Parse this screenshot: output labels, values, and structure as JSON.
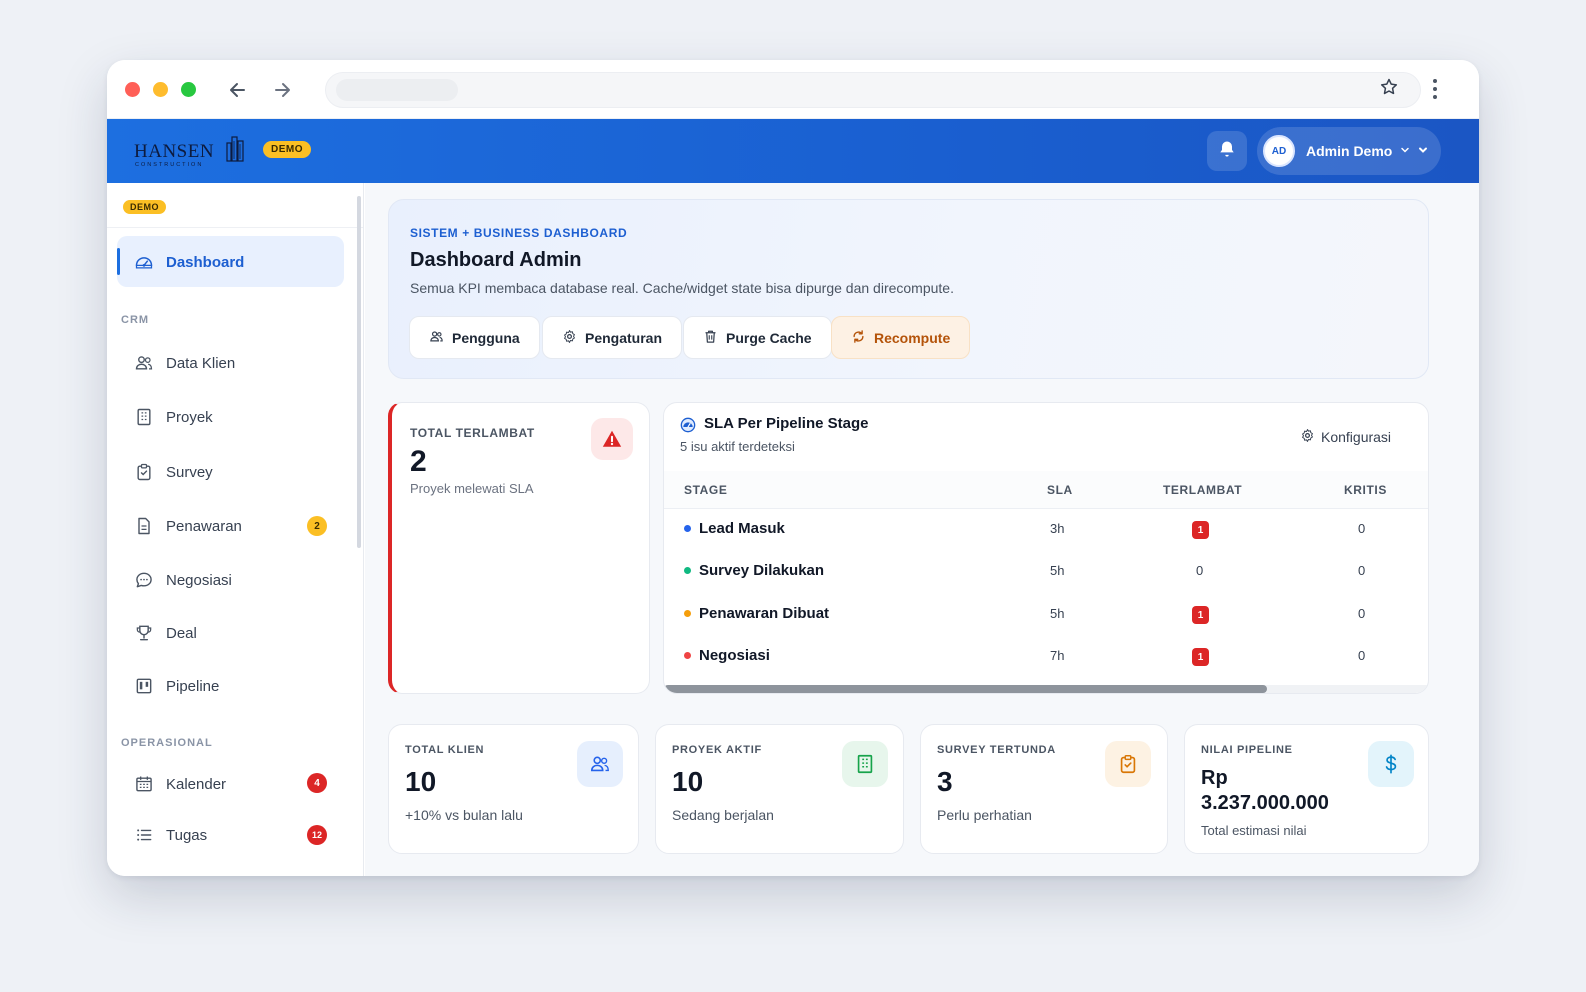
{
  "browser": {
    "icons": [
      "arrow-left-icon",
      "arrow-right-icon",
      "star-icon",
      "kebab-menu-icon"
    ]
  },
  "header": {
    "logo_text": "HANSEN",
    "logo_subtext": "CONSTRUCTION",
    "demo_badge": "DEMO",
    "avatar_initials": "AD",
    "user_name": "Admin Demo",
    "brand_color": "#1d6fe0"
  },
  "sidebar": {
    "demo_badge": "DEMO",
    "active_item": {
      "label": "Dashboard",
      "icon": "gauge-icon"
    },
    "sections": [
      {
        "title": "CRM",
        "items": [
          {
            "label": "Data Klien",
            "icon": "users-icon"
          },
          {
            "label": "Proyek",
            "icon": "building-icon"
          },
          {
            "label": "Survey",
            "icon": "clipboard-check-icon"
          },
          {
            "label": "Penawaran",
            "icon": "document-icon",
            "count": "2"
          },
          {
            "label": "Negosiasi",
            "icon": "chat-bubble-icon"
          },
          {
            "label": "Deal",
            "icon": "trophy-icon"
          },
          {
            "label": "Pipeline",
            "icon": "kanban-icon"
          }
        ]
      },
      {
        "title": "OPERASIONAL",
        "items": [
          {
            "label": "Kalender",
            "icon": "calendar-icon",
            "count": "4"
          },
          {
            "label": "Tugas",
            "icon": "list-icon",
            "count": "12"
          }
        ]
      }
    ]
  },
  "hero": {
    "eyebrow": "SISTEM + BUSINESS DASHBOARD",
    "title": "Dashboard Admin",
    "description": "Semua KPI membaca database real. Cache/widget state bisa dipurge dan direcompute.",
    "buttons": [
      {
        "label": "Pengguna",
        "icon": "users-icon"
      },
      {
        "label": "Pengaturan",
        "icon": "gear-icon"
      },
      {
        "label": "Purge Cache",
        "icon": "trash-icon"
      },
      {
        "label": "Recompute",
        "icon": "refresh-icon"
      }
    ]
  },
  "late_card": {
    "label": "TOTAL TERLAMBAT",
    "value": "2",
    "subtitle": "Proyek melewati SLA",
    "icon": "warning-icon"
  },
  "sla_table": {
    "title": "SLA Per Pipeline Stage",
    "subtitle": "5 isu aktif terdeteksi",
    "config_label": "Konfigurasi",
    "columns": [
      "STAGE",
      "SLA",
      "TERLAMBAT",
      "KRITIS"
    ],
    "rows": [
      {
        "stage": "Lead Masuk",
        "color": "#2563eb",
        "sla": "3h",
        "late": "1",
        "late_badge": true,
        "critical": "0"
      },
      {
        "stage": "Survey Dilakukan",
        "color": "#10b981",
        "sla": "5h",
        "late": "0",
        "late_badge": false,
        "critical": "0"
      },
      {
        "stage": "Penawaran Dibuat",
        "color": "#f59e0b",
        "sla": "5h",
        "late": "1",
        "late_badge": true,
        "critical": "0"
      },
      {
        "stage": "Negosiasi",
        "color": "#ef4444",
        "sla": "7h",
        "late": "1",
        "late_badge": true,
        "critical": "0"
      }
    ]
  },
  "kpis": [
    {
      "label": "TOTAL KLIEN",
      "value": "10",
      "subtitle": "+10% vs bulan lalu",
      "icon": "users-icon",
      "accent": "#2563eb"
    },
    {
      "label": "PROYEK AKTIF",
      "value": "10",
      "subtitle": "Sedang berjalan",
      "icon": "building-icon",
      "accent": "#16a34a"
    },
    {
      "label": "SURVEY TERTUNDA",
      "value": "3",
      "subtitle": "Perlu perhatian",
      "icon": "clipboard-check-icon",
      "accent": "#d97706"
    },
    {
      "label": "NILAI PIPELINE",
      "value_line1": "Rp",
      "value_line2": "3.237.000.000",
      "subtitle": "Total estimasi nilai",
      "icon": "dollar-icon",
      "accent": "#0284c7"
    }
  ]
}
